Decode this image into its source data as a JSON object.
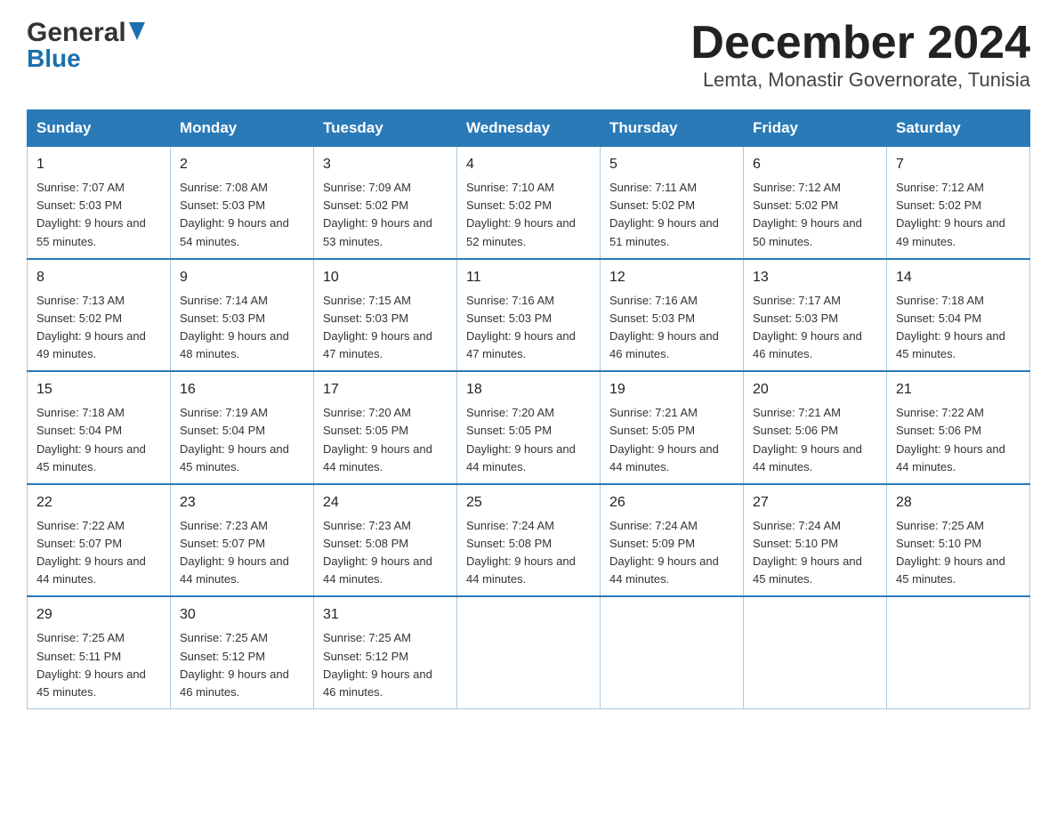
{
  "header": {
    "logo_line1": "General",
    "logo_line2": "Blue",
    "title": "December 2024",
    "subtitle": "Lemta, Monastir Governorate, Tunisia"
  },
  "weekdays": [
    "Sunday",
    "Monday",
    "Tuesday",
    "Wednesday",
    "Thursday",
    "Friday",
    "Saturday"
  ],
  "weeks": [
    [
      {
        "num": "1",
        "sunrise": "7:07 AM",
        "sunset": "5:03 PM",
        "daylight": "9 hours and 55 minutes."
      },
      {
        "num": "2",
        "sunrise": "7:08 AM",
        "sunset": "5:03 PM",
        "daylight": "9 hours and 54 minutes."
      },
      {
        "num": "3",
        "sunrise": "7:09 AM",
        "sunset": "5:02 PM",
        "daylight": "9 hours and 53 minutes."
      },
      {
        "num": "4",
        "sunrise": "7:10 AM",
        "sunset": "5:02 PM",
        "daylight": "9 hours and 52 minutes."
      },
      {
        "num": "5",
        "sunrise": "7:11 AM",
        "sunset": "5:02 PM",
        "daylight": "9 hours and 51 minutes."
      },
      {
        "num": "6",
        "sunrise": "7:12 AM",
        "sunset": "5:02 PM",
        "daylight": "9 hours and 50 minutes."
      },
      {
        "num": "7",
        "sunrise": "7:12 AM",
        "sunset": "5:02 PM",
        "daylight": "9 hours and 49 minutes."
      }
    ],
    [
      {
        "num": "8",
        "sunrise": "7:13 AM",
        "sunset": "5:02 PM",
        "daylight": "9 hours and 49 minutes."
      },
      {
        "num": "9",
        "sunrise": "7:14 AM",
        "sunset": "5:03 PM",
        "daylight": "9 hours and 48 minutes."
      },
      {
        "num": "10",
        "sunrise": "7:15 AM",
        "sunset": "5:03 PM",
        "daylight": "9 hours and 47 minutes."
      },
      {
        "num": "11",
        "sunrise": "7:16 AM",
        "sunset": "5:03 PM",
        "daylight": "9 hours and 47 minutes."
      },
      {
        "num": "12",
        "sunrise": "7:16 AM",
        "sunset": "5:03 PM",
        "daylight": "9 hours and 46 minutes."
      },
      {
        "num": "13",
        "sunrise": "7:17 AM",
        "sunset": "5:03 PM",
        "daylight": "9 hours and 46 minutes."
      },
      {
        "num": "14",
        "sunrise": "7:18 AM",
        "sunset": "5:04 PM",
        "daylight": "9 hours and 45 minutes."
      }
    ],
    [
      {
        "num": "15",
        "sunrise": "7:18 AM",
        "sunset": "5:04 PM",
        "daylight": "9 hours and 45 minutes."
      },
      {
        "num": "16",
        "sunrise": "7:19 AM",
        "sunset": "5:04 PM",
        "daylight": "9 hours and 45 minutes."
      },
      {
        "num": "17",
        "sunrise": "7:20 AM",
        "sunset": "5:05 PM",
        "daylight": "9 hours and 44 minutes."
      },
      {
        "num": "18",
        "sunrise": "7:20 AM",
        "sunset": "5:05 PM",
        "daylight": "9 hours and 44 minutes."
      },
      {
        "num": "19",
        "sunrise": "7:21 AM",
        "sunset": "5:05 PM",
        "daylight": "9 hours and 44 minutes."
      },
      {
        "num": "20",
        "sunrise": "7:21 AM",
        "sunset": "5:06 PM",
        "daylight": "9 hours and 44 minutes."
      },
      {
        "num": "21",
        "sunrise": "7:22 AM",
        "sunset": "5:06 PM",
        "daylight": "9 hours and 44 minutes."
      }
    ],
    [
      {
        "num": "22",
        "sunrise": "7:22 AM",
        "sunset": "5:07 PM",
        "daylight": "9 hours and 44 minutes."
      },
      {
        "num": "23",
        "sunrise": "7:23 AM",
        "sunset": "5:07 PM",
        "daylight": "9 hours and 44 minutes."
      },
      {
        "num": "24",
        "sunrise": "7:23 AM",
        "sunset": "5:08 PM",
        "daylight": "9 hours and 44 minutes."
      },
      {
        "num": "25",
        "sunrise": "7:24 AM",
        "sunset": "5:08 PM",
        "daylight": "9 hours and 44 minutes."
      },
      {
        "num": "26",
        "sunrise": "7:24 AM",
        "sunset": "5:09 PM",
        "daylight": "9 hours and 44 minutes."
      },
      {
        "num": "27",
        "sunrise": "7:24 AM",
        "sunset": "5:10 PM",
        "daylight": "9 hours and 45 minutes."
      },
      {
        "num": "28",
        "sunrise": "7:25 AM",
        "sunset": "5:10 PM",
        "daylight": "9 hours and 45 minutes."
      }
    ],
    [
      {
        "num": "29",
        "sunrise": "7:25 AM",
        "sunset": "5:11 PM",
        "daylight": "9 hours and 45 minutes."
      },
      {
        "num": "30",
        "sunrise": "7:25 AM",
        "sunset": "5:12 PM",
        "daylight": "9 hours and 46 minutes."
      },
      {
        "num": "31",
        "sunrise": "7:25 AM",
        "sunset": "5:12 PM",
        "daylight": "9 hours and 46 minutes."
      },
      null,
      null,
      null,
      null
    ]
  ]
}
